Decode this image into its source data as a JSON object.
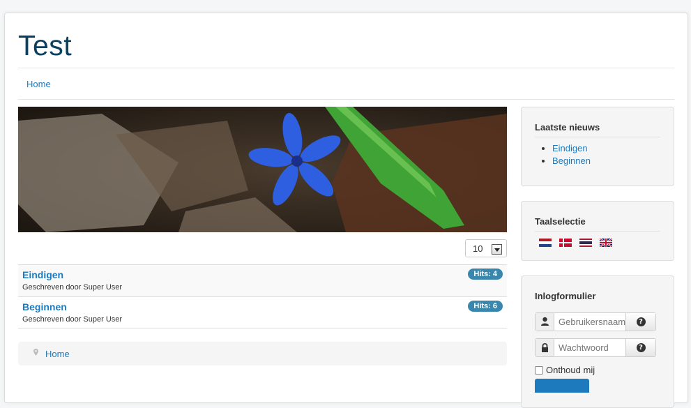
{
  "site": {
    "title": "Test"
  },
  "nav": {
    "home": "Home"
  },
  "list_controls": {
    "limit_value": "10"
  },
  "articles": [
    {
      "title": "Eindigen",
      "author": "Geschreven door Super User",
      "hits": "Hits: 4"
    },
    {
      "title": "Beginnen",
      "author": "Geschreven door Super User",
      "hits": "Hits: 6"
    }
  ],
  "breadcrumb": {
    "home": "Home"
  },
  "sidebar": {
    "latest_news": {
      "title": "Laatste nieuws",
      "items": [
        "Eindigen",
        "Beginnen"
      ]
    },
    "language": {
      "title": "Taalselectie",
      "flags": [
        "nl-flag-icon",
        "dk-flag-icon",
        "th-flag-icon",
        "gb-flag-icon"
      ]
    },
    "login": {
      "title": "Inlogformulier",
      "username_placeholder": "Gebruikersnaam",
      "password_placeholder": "Wachtwoord",
      "remember_label": "Onthoud mij"
    }
  },
  "colors": {
    "accent": "#1d7bbd",
    "title": "#0b4060",
    "badge": "#3a87ad"
  }
}
